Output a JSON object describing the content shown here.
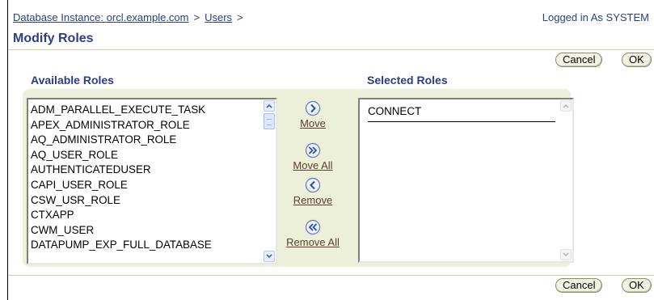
{
  "breadcrumb": {
    "database_instance": "Database Instance: orcl.example.com",
    "separator": ">",
    "users": "Users"
  },
  "login_status": "Logged in As SYSTEM",
  "page_title": "Modify Roles",
  "buttons": {
    "cancel": "Cancel",
    "ok": "OK"
  },
  "available_roles": {
    "label": "Available Roles",
    "items": [
      "ADM_PARALLEL_EXECUTE_TASK",
      "APEX_ADMINISTRATOR_ROLE",
      "AQ_ADMINISTRATOR_ROLE",
      "AQ_USER_ROLE",
      "AUTHENTICATEDUSER",
      "CAPI_USER_ROLE",
      "CSW_USR_ROLE",
      "CTXAPP",
      "CWM_USER",
      "DATAPUMP_EXP_FULL_DATABASE"
    ]
  },
  "selected_roles": {
    "label": "Selected Roles",
    "items": [
      "CONNECT"
    ]
  },
  "shuttle_actions": {
    "move": "Move",
    "move_all": "Move All",
    "remove": "Remove",
    "remove_all": "Remove All"
  },
  "colors": {
    "link_blue": "#2b3e83",
    "shuttle_bg": "#ecf0d8",
    "action_brown": "#5a3f2a"
  }
}
